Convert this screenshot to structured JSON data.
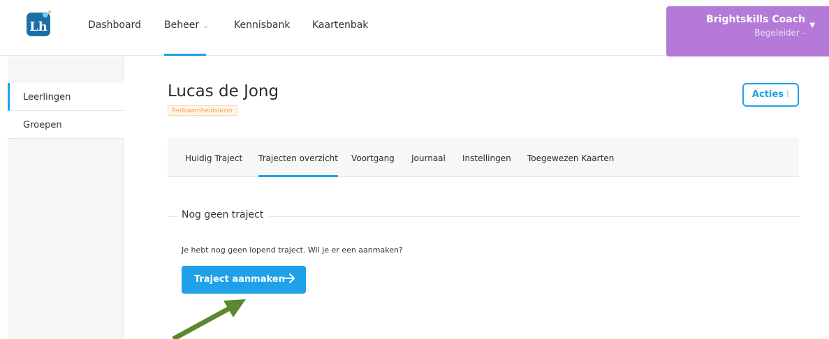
{
  "nav": {
    "logo_text": "Lh",
    "items": [
      {
        "label": "Dashboard"
      },
      {
        "label": "Beheer"
      },
      {
        "label": "Kennisbank"
      },
      {
        "label": "Kaartenbak"
      }
    ],
    "active_item": "Beheer"
  },
  "user": {
    "name": "Brightskills Coach",
    "role": "Begeleider -"
  },
  "sidebar": {
    "items": [
      {
        "label": "Leerlingen"
      },
      {
        "label": "Groepen"
      }
    ],
    "active_item": "Leerlingen"
  },
  "student": {
    "name": "Lucas de Jong",
    "badge": "Redzaamheidslezer"
  },
  "actions": {
    "label": "Acties"
  },
  "tabs": {
    "items": [
      {
        "label": "Huidig Traject"
      },
      {
        "label": "Trajecten overzicht"
      },
      {
        "label": "Voortgang"
      },
      {
        "label": "Journaal"
      },
      {
        "label": "Instellingen"
      },
      {
        "label": "Toegewezen Kaarten"
      }
    ],
    "active_item": "Trajecten overzicht"
  },
  "empty_state": {
    "legend": "Nog geen traject",
    "message": "Je hebt nog geen lopend traject. Wil je er een aanmaken?",
    "button_label": "Traject aanmaken"
  },
  "colors": {
    "accent": "#1ea1e8",
    "user_box": "#b57ad8",
    "badge_text": "#f4a64a",
    "annotation_arrow": "#5a8a2c"
  }
}
